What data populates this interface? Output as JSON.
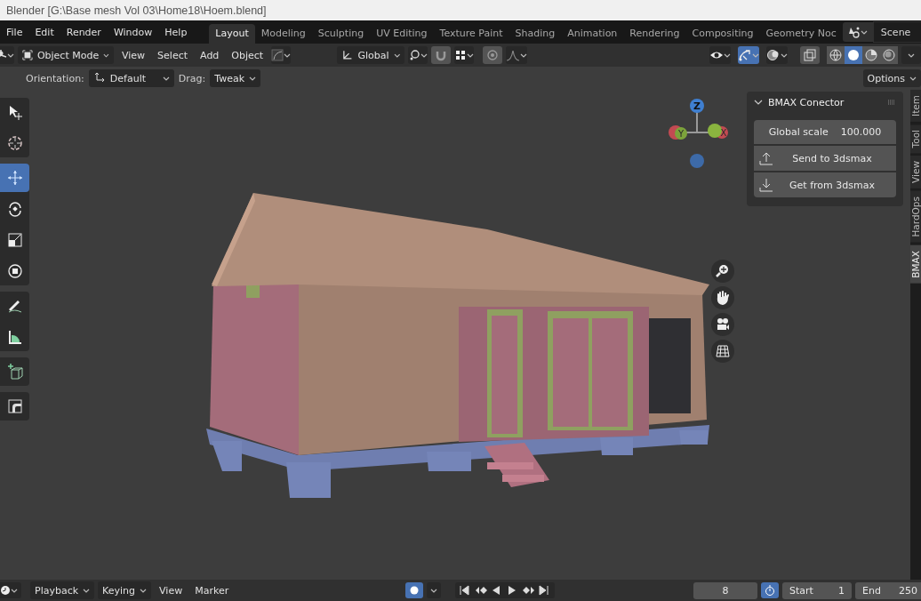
{
  "window": {
    "title": "Blender [G:\\Base mesh Vol 03\\Home18\\Hoem.blend]"
  },
  "menu": [
    "File",
    "Edit",
    "Render",
    "Window",
    "Help"
  ],
  "workspaces": [
    {
      "label": "Layout",
      "selected": true
    },
    {
      "label": "Modeling",
      "selected": false
    },
    {
      "label": "Sculpting",
      "selected": false
    },
    {
      "label": "UV Editing",
      "selected": false
    },
    {
      "label": "Texture Paint",
      "selected": false
    },
    {
      "label": "Shading",
      "selected": false
    },
    {
      "label": "Animation",
      "selected": false
    },
    {
      "label": "Rendering",
      "selected": false
    },
    {
      "label": "Compositing",
      "selected": false
    },
    {
      "label": "Geometry Noc",
      "selected": false
    }
  ],
  "scene": "Scene",
  "header": {
    "mode": "Object Mode",
    "menus": [
      "View",
      "Select",
      "Add",
      "Object"
    ],
    "transform_orientation": "Global",
    "toggles": [
      {
        "kind": "visibility",
        "on": false
      },
      {
        "kind": "gizmos",
        "on": true
      },
      {
        "kind": "overlays",
        "on": false
      }
    ],
    "shading": [
      {
        "kind": "wireframe",
        "selected": false
      },
      {
        "kind": "solid",
        "selected": true
      },
      {
        "kind": "material",
        "selected": false
      },
      {
        "kind": "rendered",
        "selected": false
      }
    ]
  },
  "tool_settings": {
    "orientation_label": "Orientation:",
    "orientation": "Default",
    "drag_label": "Drag:",
    "drag": "Tweak",
    "options": "Options"
  },
  "tools": [
    {
      "kind": "tweak",
      "selected": false
    },
    {
      "kind": "cursor",
      "selected": false
    },
    {
      "kind": "move",
      "selected": true
    },
    {
      "kind": "rotate",
      "selected": false
    },
    {
      "kind": "scale",
      "selected": false
    },
    {
      "kind": "transform",
      "selected": false
    },
    {
      "kind": "annotate",
      "selected": false
    },
    {
      "kind": "measure",
      "selected": false
    },
    {
      "kind": "add-cube",
      "selected": false
    },
    {
      "kind": "shear",
      "selected": false
    }
  ],
  "gizmo": {
    "axes": [
      "Z",
      "Y",
      "X"
    ]
  },
  "sidebar": {
    "panel": {
      "title": "BMAX Conector",
      "expanded": true,
      "field_label": "Global scale",
      "field_value": "100.000",
      "buttons": [
        {
          "kind": "upload",
          "label": "Send to 3dsmax"
        },
        {
          "kind": "download",
          "label": "Get from 3dsmax"
        }
      ]
    },
    "tabs": [
      {
        "label": "Item",
        "selected": false
      },
      {
        "label": "Tool",
        "selected": false
      },
      {
        "label": "View",
        "selected": false
      },
      {
        "label": "HardOps",
        "selected": false
      },
      {
        "label": "BMAX",
        "selected": true
      }
    ]
  },
  "timeline": {
    "menus": [
      "Playback",
      "Keying"
    ],
    "links": [
      "View",
      "Marker"
    ],
    "current_frame": "8",
    "start_label": "Start",
    "start": "1",
    "end_label": "End",
    "end": "250"
  }
}
